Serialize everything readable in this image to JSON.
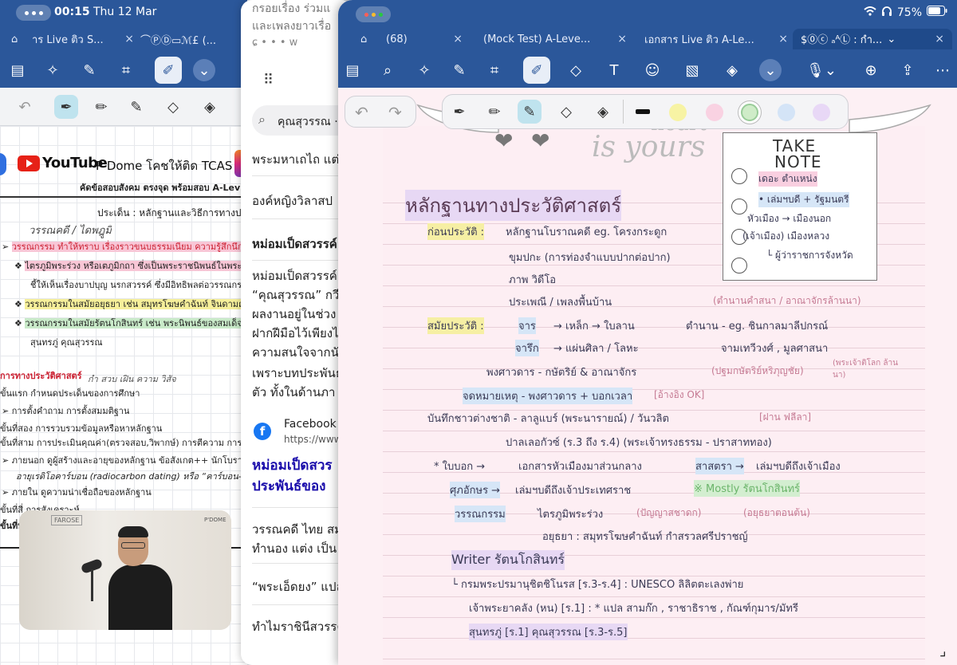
{
  "status_bar": {
    "time": "00:15",
    "date": "Thu 12 Mar",
    "battery": "75%"
  },
  "left_window": {
    "tabs": [
      {
        "label": "าร Live ติว S..."
      },
      {
        "label": "⌒ⓅⒹ▭ℳ£ (..."
      }
    ],
    "header": {
      "youtube": "YouTube",
      "channel": "P’Dome โคชให้ติด TCAS",
      "subtitle": "คัดข้อสอบสังคม ตรงจุด พร้อมสอบ A-Lev"
    },
    "lines": [
      "ประเด็น : หลักฐานและวิธีการทางประ",
      "วรรณคดี / ไดพฎูมิ",
      "วรรณกรรม ทำให้ทราบ เรื่องราวขนบธรรมเนียม ความรู้สึกนึกคิดที่แฝงอ",
      "ไตรภูมิพระร่วง หรือเตภูมิกถา ซึ่งเป็นพระราชนิพนธ์ในพระมหาธร",
      "ชี้ให้เห็นเรื่องบาปบุญ นรกสวรรค์ ซึ่งมีอิทธิพลต่อวรรณกรรม และศิ",
      "วรรณกรรมในสมัยอยุธยา เช่น สมุทรโฆษคำฉันท์ จินดามณี กำสรว",
      "วรรณกรรมในสมัยรัตนโกสินทร์ เช่น พระนิพนธ์ของสมเด็จฯ กรมพ",
      "สุนทรภู่ คุณสุวรรณ",
      "การทางประวัติศาสตร์",
      "กำ  สวบ เฝิน ความ วิสัจ",
      "ขั้นแรก กำหนดประเด็นของการศึกษา",
      "การตั้งคำถาม การตั้งสมมติฐาน",
      "ขั้นที่สอง การรวบรวมข้อมูลหรือหาหลักฐาน",
      "ขั้นที่สาม การประเมินคุณค่า(ตรวจสอบ,วิพากษ์)  การตีความ การวิเคราะห์",
      "ภายนอก ดูผู้สร้างและอายุของหลักฐาน ข้อสังเกต++ นักโบราณคดีคำน",
      "อายุเรดิโอคาร์บอน (radiocarbon dating) หรือ “คาร์บอน-14”",
      "ภายใน ดูความน่าเชื่อถือของหลักฐาน",
      "ขั้นที่สี่ การสังเคราะห์",
      "ขั้นที่ห"
    ]
  },
  "middle_window": {
    "top_text": [
      "กรอยเรื่อง ร่วมแ",
      "และเพลงยาวเรื่อ"
    ],
    "search": "คุณสุวรรณ ·",
    "items": [
      "พระมหาเถไถ แต่",
      "องค์หญิงวิลาสป",
      "หม่อมเป็ดสวรรค์"
    ],
    "paragraph": [
      "หม่อมเป็ดสวรรค์",
      "“คุณสุวรรณ” กวี",
      "ผลงานอยู่ในช่วง",
      "ฝากฝีมือไว้เพียงไ",
      "ความสนใจจากนั",
      "เพราะบทประพันธ",
      "ตัว ทั้งในด้านภา"
    ],
    "facebook": {
      "name": "Facebook",
      "url": "https://www.f"
    },
    "link": [
      "หม่อมเป็ดสวร",
      "ประพันธ์ของ"
    ],
    "more": [
      "วรรณคดี ไทย สม",
      "ทำนอง แต่ง เป็น",
      "“พระเอ็ดยง” แปล",
      "ทำไมราชินีสวรรค"
    ]
  },
  "right_window": {
    "tabs": [
      {
        "label": "(68)"
      },
      {
        "label": "(Mock Test) A-Leve..."
      },
      {
        "label": "เอกสาร Live ติว A-Le..."
      },
      {
        "label": "$⓪ⓒ ₐᴬⓁ : กำ..."
      }
    ],
    "colors": {
      "tabbar": "#2b579a",
      "paper": "#fdeef3"
    },
    "header_art": {
      "line1": "heart",
      "line2": "is yours"
    },
    "take_note": {
      "title1": "TAKE",
      "title2": "NOTE",
      "items": [
        "เดอะ ตำแหน่ง",
        "• เล่มฯบดี + รัฐมนตรี",
        "หัวเมือง → เมืองนอก",
        "(เจ้าเมือง)  เมืองหลวง",
        "└ ผู้ว่าราชการจังหวัด"
      ]
    },
    "notes": {
      "title": "หลักฐานทางประวัติศาสตร์",
      "l1a": "ก่อนประวัติ :",
      "l1b": "หลักฐานโบราณคดี  eg. โครงกระดูก",
      "l2": "ขุมปกะ  (การท่องจำแบบปากต่อปาก)",
      "l3": "ภาพ วิดีโอ",
      "l4": "ประเพณี / เพลงพื้นบ้าน",
      "l4r": "(ตำนานคำสนา / อาณาจักรล้านนา)",
      "l5a": "สมัยประวัติ :",
      "l5b": "จาร",
      "l5c": "→ เหล็ก → ใบลาน",
      "l5d": "ตำนาน - eg. ชินกาลมาลีปกรณ์",
      "l6b": "จารึก",
      "l6c": "→ แผ่นศิลา / โลหะ",
      "l6d": "จามเทวีวงศ์ , มูลศาสนา",
      "l7": "พงศาวดาร - กษัตริย์ & อาณาจักร",
      "l7r": "(ปฐมกษัตริย์หริภุญชัย)",
      "l7rr": "(พระเจ้าติโลก ล้านนา)",
      "l8": "จดหมายเหตุ - พงศาวดาร + บอกเวลา",
      "l8r": "[อ้างอิง OK]",
      "l9": "บันทึกชาวต่างชาติ - ลาลูแบร์ (พระนารายณ์) / วันวลิต",
      "l9r": "[ฝาน ฟลีลา]",
      "l10": "ปาลเลอกัวซ์ (ร.3 ถึง ร.4)  (พระเจ้าทรงธรรม - ปราสาททอง)",
      "l11a": "* ใบบอก →",
      "l11b": "เอกสารหัวเมืองมาส่วนกลาง",
      "l11c": "สาสตรา →",
      "l11d": "เล่มฯบดีถึงเจ้าเมือง",
      "l12a": "ศุภอักษร →",
      "l12b": "เล่มฯบดีถึงเจ้าประเทศราช",
      "l12c": "※ Mostly รัตนโกสินทร์",
      "l13a": "วรรณกรรม",
      "l13b": "ไตรภูมิพระร่วง",
      "l13c": "(ปัญญาสชาดก)",
      "l13d": "(อยุธยาตอนต้น)",
      "l14": "อยุธยา : สมุทรโฆษคำฉันท์  กำสรวลศรีปราชญ์",
      "l15": "Writer รัตนโกสินทร์",
      "l16": "└ กรมพระปรมานุชิตชิโนรส [ร.3-ร.4] : UNESCO ลิลิตตะเลงพ่าย",
      "l17": "เจ้าพระยาคลัง (หน) [ร.1] : * แปล สามก๊ก , ราชาธิราช , กัณฑ์กุมาร/มัทรี",
      "l18": "สุนทรภู่ [ร.1]  คุณสุวรรณ [ร.3-ร.5]"
    }
  },
  "video": {
    "brand_left": "FAROSE",
    "brand_right": "P'DOME"
  }
}
